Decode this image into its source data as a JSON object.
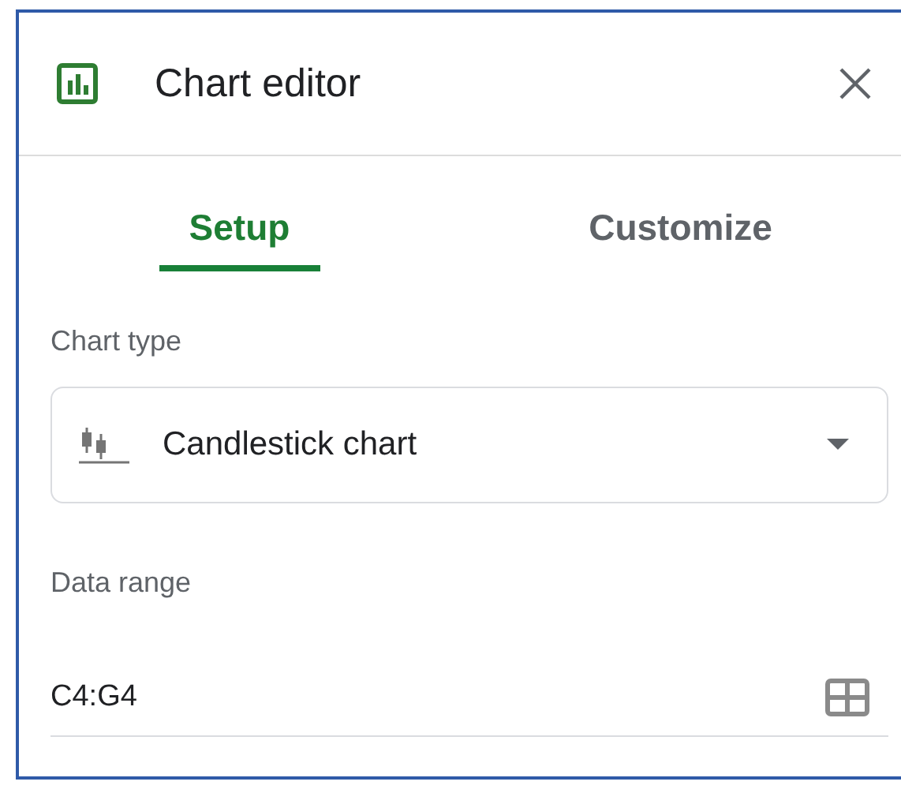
{
  "header": {
    "title": "Chart editor"
  },
  "tabs": [
    {
      "label": "Setup",
      "selected": true
    },
    {
      "label": "Customize",
      "selected": false
    }
  ],
  "chart_type": {
    "label": "Chart type",
    "value": "Candlestick chart"
  },
  "data_range": {
    "label": "Data range",
    "value": "C4:G4"
  }
}
